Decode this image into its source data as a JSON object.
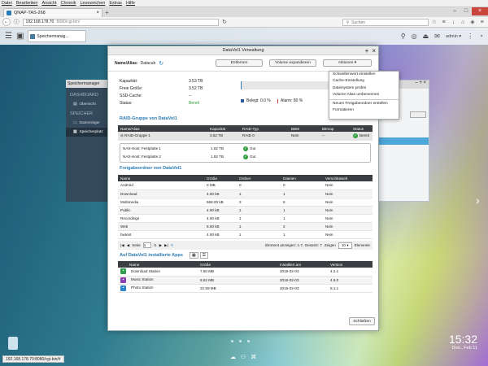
{
  "menubar": [
    "Datei",
    "Bearbeiten",
    "Ansicht",
    "Chronik",
    "Lesezeichen",
    "Extras",
    "Hilfe"
  ],
  "browser": {
    "tab_title": "QNAP-TAS-268",
    "url_host": "192.168.178.70",
    "url_rest": ":8080/cgi-bin/",
    "search_placeholder": "Suchen"
  },
  "qts": {
    "tab_label": "Speichermanag...",
    "user": "admin"
  },
  "bgwin": {
    "title": "Speichermanager",
    "sections": [
      {
        "label": "DASHBOARD",
        "items": [
          "Übersicht"
        ]
      },
      {
        "label": "SPEICHER",
        "items": [
          "Datenträger",
          "Speicherplatz"
        ]
      }
    ]
  },
  "dialog": {
    "title": "DataVol1 Verwaltung",
    "name_label": "Name/Alias:",
    "name_value": "Datacub",
    "buttons": {
      "remove": "Entfernen",
      "expand": "Volume expandieren",
      "actions": "Aktionen"
    },
    "info": [
      {
        "k": "Kapazität:",
        "v": "3.53 TB"
      },
      {
        "k": "Freie Größe:",
        "v": "3.52 TB"
      },
      {
        "k": "SSD-Cache:",
        "v": "--"
      },
      {
        "k": "Status:",
        "v": "Bereit"
      }
    ],
    "usage": {
      "used": "Belegt: 0.0 %",
      "alarm": "Alarm: 80 %",
      "used_fraction": 0.002
    },
    "raid_title": "RAID-Gruppe von DataVol1",
    "raid_headers": [
      "Name/Alias",
      "Kapazität",
      "RAID-Typ",
      "BBM",
      "Bitmap",
      "Status"
    ],
    "raid_row": [
      "RAID-Gruppe 1",
      "3.62 TB",
      "RAID 0",
      "Nein",
      "--",
      "Bereit"
    ],
    "disks": [
      {
        "name": "NAS-Host: Festplatte 1",
        "cap": "1.82 TB",
        "status": "Gut"
      },
      {
        "name": "NAS-Host: Festplatte 2",
        "cap": "1.82 TB",
        "status": "Gut"
      }
    ],
    "shares_title": "Freigabeordner von DataVol1",
    "share_headers": [
      "Name",
      "Größe",
      "Ordner",
      "Dateien",
      "Verschlüsselt"
    ],
    "shares": [
      [
        "Android",
        "0 MB",
        "0",
        "0",
        "Nein"
      ],
      [
        "Download",
        "4.00 kB",
        "1",
        "1",
        "Nein"
      ],
      [
        "Multimedia",
        "568.00 kB",
        "3",
        "6",
        "Nein"
      ],
      [
        "Public",
        "4.00 kB",
        "1",
        "1",
        "Nein"
      ],
      [
        "Recordings",
        "4.00 kB",
        "1",
        "1",
        "Nein"
      ],
      [
        "Web",
        "8.00 kB",
        "1",
        "2",
        "Nein"
      ],
      [
        "hwtest",
        "4.00 kB",
        "1",
        "1",
        "Nein"
      ]
    ],
    "pager": {
      "page_label": "Seite",
      "page": "1",
      "of": "/1",
      "display": "Element anzeigen: 1-7, Gesamt: 7",
      "show": "Zeigen",
      "per_page": "10",
      "items": "Elemente"
    },
    "apps_title": "Auf DataVol1 installierte Apps",
    "app_headers": [
      "Name",
      "Größe",
      "Installiert am",
      "Version"
    ],
    "apps": [
      {
        "name": "Download Station",
        "size": "7.50 MB",
        "date": "2016-02-03",
        "ver": "4.2.1",
        "color": "#2f9e4a"
      },
      {
        "name": "Music Station",
        "size": "8.62 MB",
        "date": "2016-02-03",
        "ver": "4.8.0",
        "color": "#8a3fb0"
      },
      {
        "name": "Photo Station",
        "size": "22.59 MB",
        "date": "2016-02-03",
        "ver": "5.1.1",
        "color": "#2a86c8"
      }
    ],
    "close": "Schließen"
  },
  "menu": [
    "Schwellenwert einstellen",
    "Cache-Einstellung",
    "Dateisystem prüfen",
    "Volume-Alias umbenennen",
    "Neuen Freigabeordner erstellen",
    "Formatieren"
  ],
  "clock": {
    "time": "15:32",
    "date": "Don., Feb 11"
  },
  "status": "192.168.178.70:8080/cgi-bin/#"
}
